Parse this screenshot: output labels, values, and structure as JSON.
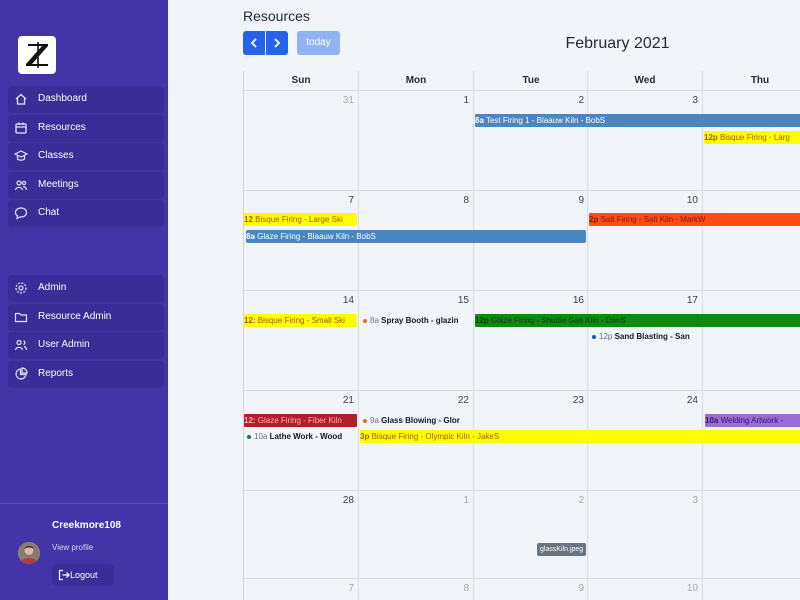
{
  "sidebar": {
    "items": [
      {
        "label": "Dashboard",
        "icon": "home-icon"
      },
      {
        "label": "Resources",
        "icon": "calendar-icon"
      },
      {
        "label": "Classes",
        "icon": "graduation-cap-icon"
      },
      {
        "label": "Meetings",
        "icon": "users-icon"
      },
      {
        "label": "Chat",
        "icon": "chat-bubble-icon"
      }
    ],
    "admin_items": [
      {
        "label": "Admin",
        "icon": "gear-icon"
      },
      {
        "label": "Resource Admin",
        "icon": "folder-icon"
      },
      {
        "label": "User Admin",
        "icon": "user-group-icon"
      },
      {
        "label": "Reports",
        "icon": "pie-chart-icon"
      }
    ],
    "user": {
      "name": "Creekmore108",
      "view_profile": "View profile",
      "logout": "Logout"
    }
  },
  "header": {
    "title": "Resources",
    "today": "today",
    "month": "February 2021"
  },
  "calendar": {
    "days_of_week": [
      "Sun",
      "Mon",
      "Tue",
      "Wed",
      "Thu"
    ],
    "weeks": [
      [
        "31",
        "1",
        "2",
        "3",
        ""
      ],
      [
        "7",
        "8",
        "9",
        "10",
        ""
      ],
      [
        "14",
        "15",
        "16",
        "17",
        ""
      ],
      [
        "21",
        "22",
        "23",
        "24",
        ""
      ],
      [
        "28",
        "1",
        "2",
        "3",
        ""
      ],
      [
        "7",
        "8",
        "9",
        "10",
        ""
      ]
    ],
    "events": [
      {
        "time": "8a",
        "title": "Test Firing 1 - Blaauw Kiln - BobS"
      },
      {
        "time": "12p",
        "title": "Bisque Firing - Larg"
      },
      {
        "time": "12",
        "title": "Bisque Firing - Large Ski"
      },
      {
        "time": "2p",
        "title": "Salt Firing - Salt Kiln - MarkW"
      },
      {
        "time": "8a",
        "title": "Glaze Firing - Blaauw Kiln - BobS"
      },
      {
        "time": "12:",
        "title": "Bisque Firing - Small Ski"
      },
      {
        "time": "8a",
        "title": "Spray Booth - glazin"
      },
      {
        "time": "12p",
        "title": "Glaze Firing - Shuttle Gas Kiln - DonS"
      },
      {
        "time": "12p",
        "title": "Sand Blasting - San"
      },
      {
        "time": "12:",
        "title": "Glaze Firing - Fiber Kiln"
      },
      {
        "time": "9a",
        "title": "Glass Blowing - Glor"
      },
      {
        "time": "10a",
        "title": "Welding Artwork -"
      },
      {
        "time": "10a",
        "title": "Lathe Work - Wood"
      },
      {
        "time": "3p",
        "title": "Bisque Firing - Olympic Kiln - JakeS"
      }
    ],
    "event_colors": {
      "steel_blue": "#4a86bf",
      "yellow": "#ffff00",
      "orange_red": "#ff4d12",
      "green": "#0f8a0f",
      "dark_red": "#b0202a",
      "purple": "#9b6ad4",
      "dot_orange": "#e07020",
      "dot_blue": "#1d4ed8",
      "dot_green": "#15803d"
    }
  },
  "tooltip": "glassKiln.jpeg",
  "colors": {
    "sidebar": "#4335a7",
    "nav_item": "#3a2d98",
    "primary_button": "#2563eb",
    "today_button": "#8fb3f3",
    "background": "#f1f4f9"
  }
}
